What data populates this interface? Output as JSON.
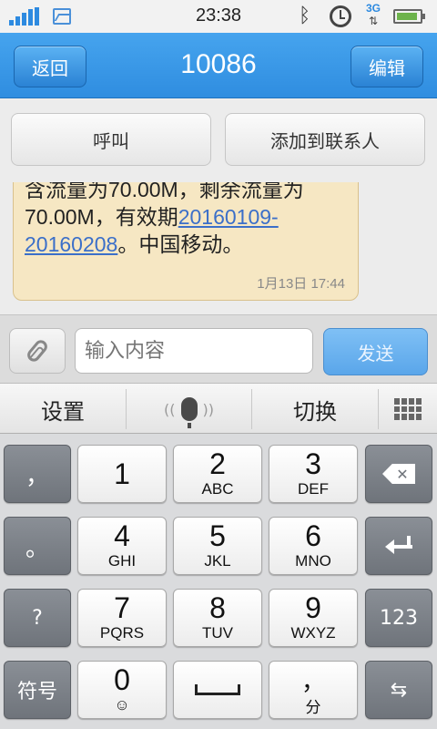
{
  "status_bar": {
    "time": "23:38",
    "network_type": "3G",
    "icons": [
      "signal-icon",
      "image-icon",
      "bluetooth-icon",
      "alarm-icon",
      "network-icon",
      "battery-icon"
    ]
  },
  "header": {
    "back_label": "返回",
    "title": "10086",
    "edit_label": "编辑"
  },
  "actions": {
    "call_label": "呼叫",
    "add_contact_label": "添加到联系人"
  },
  "message": {
    "text_part1": "含流量为70.00M，剩余流量为70.00M，有效期",
    "link_text": "20160109-20160208",
    "text_part2": "。中国移动。",
    "timestamp": "1月13日 17:44"
  },
  "compose": {
    "placeholder": "输入内容",
    "send_label": "发送"
  },
  "keyboard_toolbar": {
    "settings_label": "设置",
    "switch_label": "切换"
  },
  "keys": {
    "comma_cn": "，",
    "period_cn": "。",
    "question": "?",
    "symbol_label": "符号",
    "k1": "1",
    "k2": "2",
    "k2_sub": "ABC",
    "k3": "3",
    "k3_sub": "DEF",
    "k4": "4",
    "k4_sub": "GHI",
    "k5": "5",
    "k5_sub": "JKL",
    "k6": "6",
    "k6_sub": "MNO",
    "k7": "7",
    "k7_sub": "PQRS",
    "k8": "8",
    "k8_sub": "TUV",
    "k9": "9",
    "k9_sub": "WXYZ",
    "k0": "0",
    "k0_sub": "☺",
    "comma_key": "，",
    "comma_key_sub": "分",
    "num_mode": "123"
  },
  "colors": {
    "header_blue": "#2f8de0",
    "bubble_bg": "#f6e7c3",
    "link": "#3b6fc9"
  }
}
